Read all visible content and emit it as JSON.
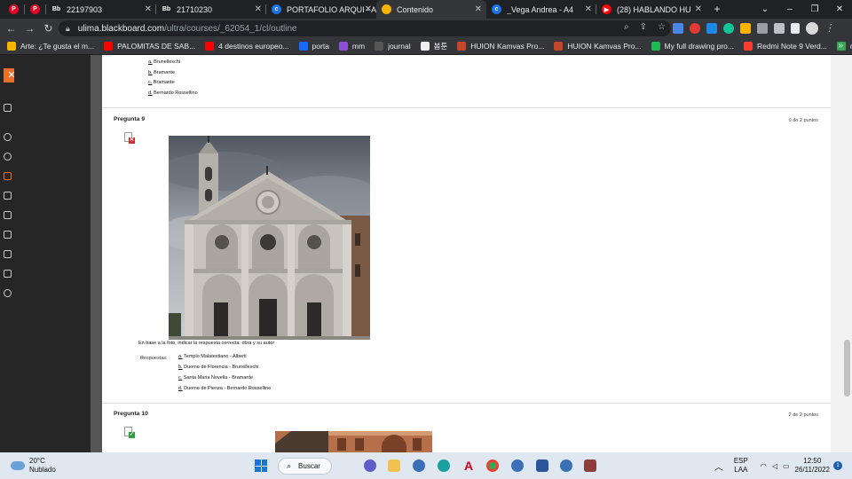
{
  "tabs": [
    {
      "favicon": "pinterest-icon",
      "color": "#e60023",
      "glyph": "P",
      "label": "",
      "width": 24
    },
    {
      "favicon": "pinterest-icon",
      "color": "#e60023",
      "glyph": "P",
      "label": "",
      "width": 24
    },
    {
      "favicon": "blackboard-icon",
      "color": "#202124",
      "glyph": "Bb",
      "label": "22197903",
      "width": 124
    },
    {
      "favicon": "blackboard-icon",
      "color": "#202124",
      "glyph": "Bb",
      "label": "21710230",
      "width": 124
    },
    {
      "favicon": "cleverpdf-icon",
      "color": "#1a73e8",
      "glyph": "c",
      "label": "PORTAFOLIO ARQUI - A4",
      "width": 124
    },
    {
      "favicon": "document-icon",
      "color": "#f5b400",
      "glyph": "",
      "label": "Contenido",
      "width": 124,
      "active": true
    },
    {
      "favicon": "cleverpdf-icon",
      "color": "#1a73e8",
      "glyph": "c",
      "label": "_Vega Andrea - A4",
      "width": 124
    },
    {
      "favicon": "youtube-icon",
      "color": "#ff0000",
      "glyph": "▶",
      "label": "(28) HABLANDO HU",
      "width": 124,
      "audio": true
    }
  ],
  "tab_controls": {
    "new_tab": "+",
    "dropdown": "⌄",
    "minimize": "–",
    "restore": "❐",
    "close": "✕"
  },
  "address_bar": {
    "host": "ulima.blackboard.com",
    "path": "/ultra/courses/_62054_1/cl/outline"
  },
  "bookmarks": [
    {
      "label": "Arte: ¿Te gusta el m...",
      "color": "#f5b400"
    },
    {
      "label": "PALOMITAS DE SAB...",
      "color": "#ff0000"
    },
    {
      "label": "4 destinos europeo...",
      "color": "#ff0000"
    },
    {
      "label": "porta",
      "color": "#1769ff"
    },
    {
      "label": "mm",
      "color": "#8a4fd8"
    },
    {
      "label": "journal",
      "color": "#555555"
    },
    {
      "label": "봄툰",
      "color": "#eeeeee"
    },
    {
      "label": "HUION Kamvas Pro...",
      "color": "#c2452d"
    },
    {
      "label": "HUION Kamvas Pro...",
      "color": "#c2452d"
    },
    {
      "label": "My full drawing pro...",
      "color": "#1db954"
    },
    {
      "label": "Redmi Note 9 Verd...",
      "color": "#ff3b30"
    },
    {
      "label": "mm",
      "color": "#34a853"
    }
  ],
  "bookmarks_more": "»",
  "close_panel": "✕",
  "prev_question": {
    "options": [
      {
        "letter": "a.",
        "text": "Brunelleschi"
      },
      {
        "letter": "b.",
        "text": "Bramante"
      },
      {
        "letter": "c.",
        "text": "Bramante"
      },
      {
        "letter": "d.",
        "text": "Bernardo Rossellino"
      }
    ]
  },
  "question9": {
    "title": "Pregunta 9",
    "points": "0 de 2 puntos",
    "status": "incorrect",
    "prompt": "En base a la foto, indicar la respuesta correcta: obra y su autor",
    "answers_label": "Respuestas:",
    "options": [
      {
        "letter": "a.",
        "text": "Templo Malatestiano - Alberti"
      },
      {
        "letter": "b.",
        "text": "Duomo de Florencia - Brunelleschi"
      },
      {
        "letter": "c.",
        "text": "Santa Maria Novella - Bramante"
      },
      {
        "letter": "d.",
        "text": "Duomo de Pienza - Bernardo Rossellino"
      }
    ]
  },
  "question10": {
    "title": "Pregunta 10",
    "points": "2 de 2 puntos",
    "status": "correct"
  },
  "taskbar": {
    "temp": "20°C",
    "condition": "Nublado",
    "search": "Buscar",
    "lang1": "ESP",
    "lang2": "LAA",
    "time": "12:50",
    "date": "26/11/2022",
    "notifications": "1"
  }
}
